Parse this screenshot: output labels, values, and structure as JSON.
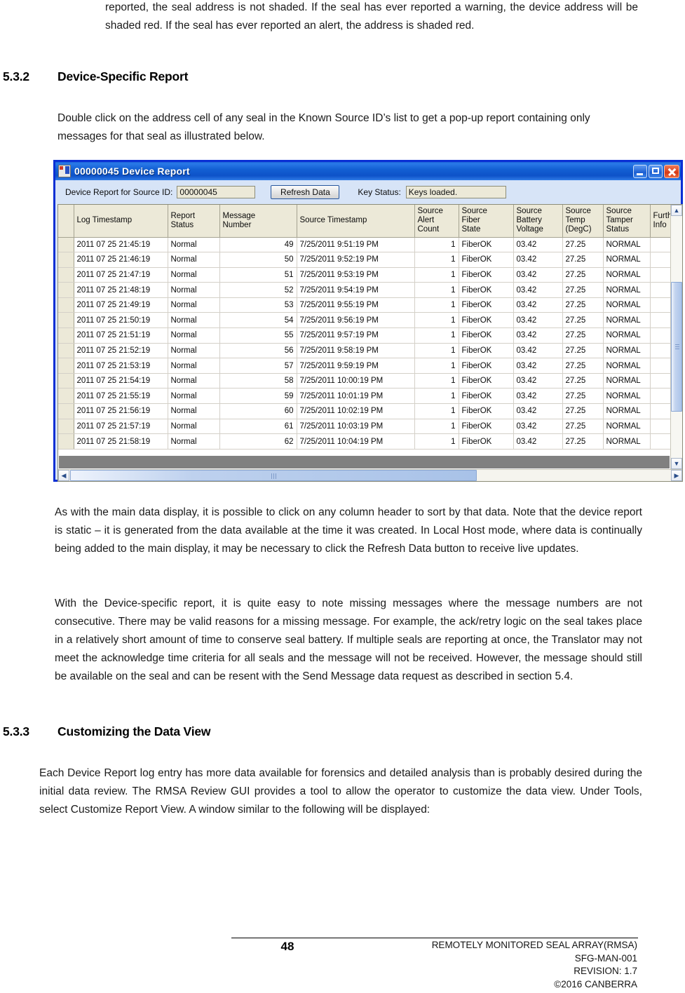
{
  "document": {
    "intro_paragraph": "reported, the seal address is not shaded.  If the seal has ever reported a warning, the device address will be shaded red.  If the seal has ever reported an alert, the address is shaded red.",
    "section_532": {
      "number": "5.3.2",
      "title": "Device-Specific Report",
      "body": "Double click on the address cell of any seal in the Known Source ID’s list to get a pop-up report containing only messages for that seal as illustrated below."
    },
    "after_figure_paragraph_1": "As with the main data display, it is possible to click on any column header to sort by that data.  Note that the device report is static – it is generated from the data available at the time it was created.  In Local Host mode, where data is continually being added to the main display, it may be necessary to click the Refresh Data button to receive live updates.",
    "after_figure_paragraph_2": "With the Device-specific report, it is quite easy to note missing messages where the message numbers are not consecutive.  There may be valid reasons for a missing message.  For example, the ack/retry logic on the seal takes place in a relatively short amount of time to conserve seal battery.  If multiple seals are reporting at once, the Translator may not meet the acknowledge time criteria for all seals and the message will not be received.  However, the message should still be available on the seal and can be resent with the Send Message data request as described in section 5.4.",
    "section_533": {
      "number": "5.3.3",
      "title": "Customizing the Data View",
      "body": "Each Device Report log entry has more data available for forensics and detailed analysis than is probably desired during the initial data review.  The RMSA Review GUI provides a tool to allow the operator to customize the data view.  Under Tools, select Customize Report View.  A window similar to the following will be displayed:"
    },
    "footer": {
      "page_number": "48",
      "line1": "REMOTELY MONITORED SEAL ARRAY(RMSA)",
      "line2": "SFG-MAN-001",
      "line3": "REVISION: 1.7",
      "line4": "©2016 CANBERRA"
    }
  },
  "window": {
    "title": "00000045 Device Report",
    "icon": "application-window-icon",
    "buttons": {
      "minimize": "minimize-icon",
      "maximize": "maximize-icon",
      "close": "close-icon"
    },
    "toolbar": {
      "source_id_label": "Device Report for Source ID:",
      "source_id_value": "00000045",
      "refresh_button": "Refresh Data",
      "key_status_label": "Key Status:",
      "key_status_value": "Keys loaded."
    },
    "grid": {
      "columns": [
        "Log Timestamp",
        "Report Status",
        "Message Number",
        "Source Timestamp",
        "Source Alert Count",
        "Source Fiber State",
        "Source Battery Voltage",
        "Source Temp (DegC)",
        "Source Tamper Status",
        "Further Report Info"
      ],
      "column_lines": [
        [
          "Log Timestamp",
          ""
        ],
        [
          "Report",
          "Status"
        ],
        [
          "Message",
          "Number"
        ],
        [
          "Source Timestamp",
          ""
        ],
        [
          "Source",
          "Alert",
          "Count"
        ],
        [
          "Source",
          "Fiber",
          "State"
        ],
        [
          "Source",
          "Battery",
          "Voltage"
        ],
        [
          "Source",
          "Temp",
          "(DegC)"
        ],
        [
          "Source",
          "Tamper",
          "Status"
        ],
        [
          "Further Report",
          "Info"
        ]
      ],
      "rows": [
        [
          "2011 07 25 21:45:19",
          "Normal",
          "49",
          "7/25/2011 9:51:19 PM",
          "1",
          "FiberOK",
          "03.42",
          "27.25",
          "NORMAL",
          ""
        ],
        [
          "2011 07 25 21:46:19",
          "Normal",
          "50",
          "7/25/2011 9:52:19 PM",
          "1",
          "FiberOK",
          "03.42",
          "27.25",
          "NORMAL",
          ""
        ],
        [
          "2011 07 25 21:47:19",
          "Normal",
          "51",
          "7/25/2011 9:53:19 PM",
          "1",
          "FiberOK",
          "03.42",
          "27.25",
          "NORMAL",
          ""
        ],
        [
          "2011 07 25 21:48:19",
          "Normal",
          "52",
          "7/25/2011 9:54:19 PM",
          "1",
          "FiberOK",
          "03.42",
          "27.25",
          "NORMAL",
          ""
        ],
        [
          "2011 07 25 21:49:19",
          "Normal",
          "53",
          "7/25/2011 9:55:19 PM",
          "1",
          "FiberOK",
          "03.42",
          "27.25",
          "NORMAL",
          ""
        ],
        [
          "2011 07 25 21:50:19",
          "Normal",
          "54",
          "7/25/2011 9:56:19 PM",
          "1",
          "FiberOK",
          "03.42",
          "27.25",
          "NORMAL",
          ""
        ],
        [
          "2011 07 25 21:51:19",
          "Normal",
          "55",
          "7/25/2011 9:57:19 PM",
          "1",
          "FiberOK",
          "03.42",
          "27.25",
          "NORMAL",
          ""
        ],
        [
          "2011 07 25 21:52:19",
          "Normal",
          "56",
          "7/25/2011 9:58:19 PM",
          "1",
          "FiberOK",
          "03.42",
          "27.25",
          "NORMAL",
          ""
        ],
        [
          "2011 07 25 21:53:19",
          "Normal",
          "57",
          "7/25/2011 9:59:19 PM",
          "1",
          "FiberOK",
          "03.42",
          "27.25",
          "NORMAL",
          ""
        ],
        [
          "2011 07 25 21:54:19",
          "Normal",
          "58",
          "7/25/2011 10:00:19 PM",
          "1",
          "FiberOK",
          "03.42",
          "27.25",
          "NORMAL",
          ""
        ],
        [
          "2011 07 25 21:55:19",
          "Normal",
          "59",
          "7/25/2011 10:01:19 PM",
          "1",
          "FiberOK",
          "03.42",
          "27.25",
          "NORMAL",
          ""
        ],
        [
          "2011 07 25 21:56:19",
          "Normal",
          "60",
          "7/25/2011 10:02:19 PM",
          "1",
          "FiberOK",
          "03.42",
          "27.25",
          "NORMAL",
          ""
        ],
        [
          "2011 07 25 21:57:19",
          "Normal",
          "61",
          "7/25/2011 10:03:19 PM",
          "1",
          "FiberOK",
          "03.42",
          "27.25",
          "NORMAL",
          ""
        ],
        [
          "2011 07 25 21:58:19",
          "Normal",
          "62",
          "7/25/2011 10:04:19 PM",
          "1",
          "FiberOK",
          "03.42",
          "27.25",
          "NORMAL",
          ""
        ]
      ],
      "scrollbars": {
        "vertical_up": "scroll-up-icon",
        "vertical_down": "scroll-down-icon",
        "horizontal_left": "scroll-left-icon",
        "horizontal_right": "scroll-right-icon"
      }
    }
  }
}
